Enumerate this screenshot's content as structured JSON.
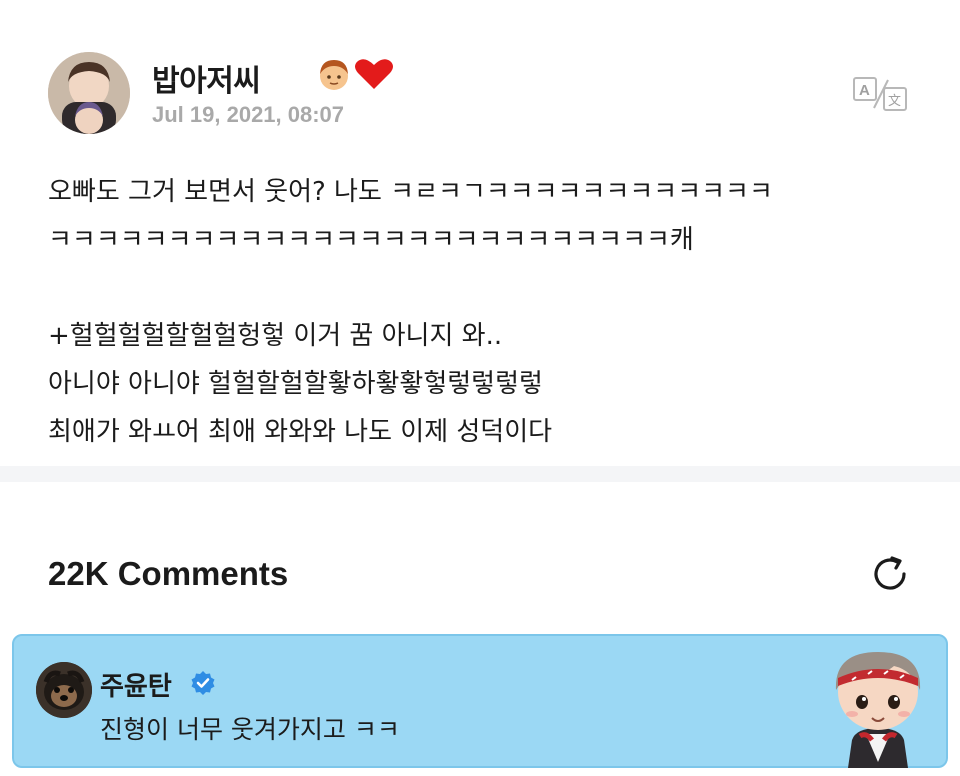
{
  "post": {
    "author_name": "밥아저씨",
    "author_emojis": [
      "boy-emoji",
      "red-heart-emoji"
    ],
    "date": "Jul 19, 2021, 08:07",
    "body_lines": [
      "오빠도 그거 보면서 웃어? 나도 ㅋㄹㅋㄱㅋㅋㅋㅋㅋㅋㅋㅋㅋㅋㅋㅋ",
      "ㅋㅋㅋㅋㅋㅋㅋㅋㅋㅋㅋㅋㅋㅋㅋㅋㅋㅋㅋㅋㅋㅋㅋㅋㅋㅋ캐",
      "",
      "+헐헐헐헐할헐헐헝헣 이거 꿈 아니지 와..",
      "아니야 아니야 헐헐할헐할홯하홯홯헣렇렇렇렇",
      "최애가 와ㅛ어 최애 와와와 나도 이제 성덕이다"
    ],
    "translate_icon": "translate-icon"
  },
  "comments": {
    "title": "22K Comments",
    "refresh_icon": "refresh-icon",
    "items": [
      {
        "author": "주윤탄",
        "verified_icon": "verified-badge-icon",
        "text": "진형이 너무 웃겨가지고 ㅋㅋ",
        "sticker": "tinytan-character-sticker",
        "highlight_color": "#9bd8f4"
      }
    ]
  }
}
